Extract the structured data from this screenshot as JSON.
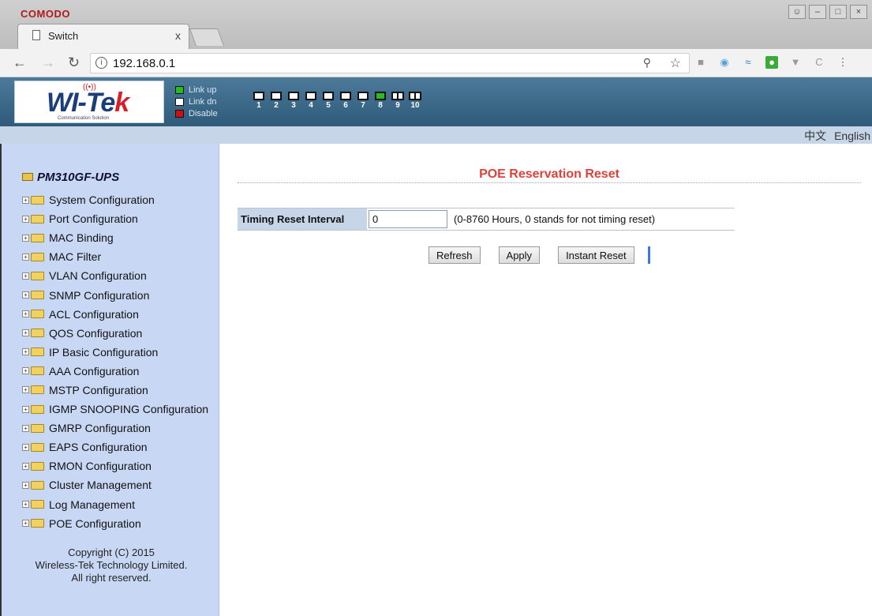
{
  "browser": {
    "brand": "COMODO",
    "tab_title": "Switch",
    "tab_close": "x",
    "url": "192.168.0.1",
    "window_controls": [
      "person-icon",
      "minimize-icon",
      "maximize-icon",
      "close-icon"
    ]
  },
  "header": {
    "logo_text": "WI-Tek",
    "logo_subtitle": "Communication Solution",
    "legend": [
      {
        "label": "Link up",
        "color": "#21c021"
      },
      {
        "label": "Link dn",
        "color": "#ffffff"
      },
      {
        "label": "Disable",
        "color": "#d01010"
      }
    ],
    "ports": [
      "1",
      "2",
      "3",
      "4",
      "5",
      "6",
      "7",
      "8",
      "9",
      "10"
    ]
  },
  "language": {
    "chinese": "中文",
    "english": "English"
  },
  "sidebar": {
    "device_name": "PM310GF-UPS",
    "items": [
      "System Configuration",
      "Port Configuration",
      "MAC Binding",
      "MAC Filter",
      "VLAN Configuration",
      "SNMP Configuration",
      "ACL Configuration",
      "QOS Configuration",
      "IP Basic Configuration",
      "AAA Configuration",
      "MSTP Configuration",
      "IGMP SNOOPING Configuration",
      "GMRP Configuration",
      "EAPS Configuration",
      "RMON Configuration",
      "Cluster Management",
      "Log Management",
      "POE Configuration"
    ],
    "copyright": [
      "Copyright (C) 2015",
      "Wireless-Tek Technology Limited.",
      "All right reserved."
    ]
  },
  "content": {
    "title": "POE Reservation Reset",
    "field_label": "Timing Reset Interval",
    "field_value": "0",
    "field_hint": "(0-8760 Hours, 0 stands for not timing reset)",
    "buttons": {
      "refresh": "Refresh",
      "apply": "Apply",
      "instant_reset": "Instant Reset"
    }
  },
  "colors": {
    "title": "#e0403a",
    "sidebar_bg": "#c8d8f4",
    "header_bg": "#3d6a8a"
  }
}
